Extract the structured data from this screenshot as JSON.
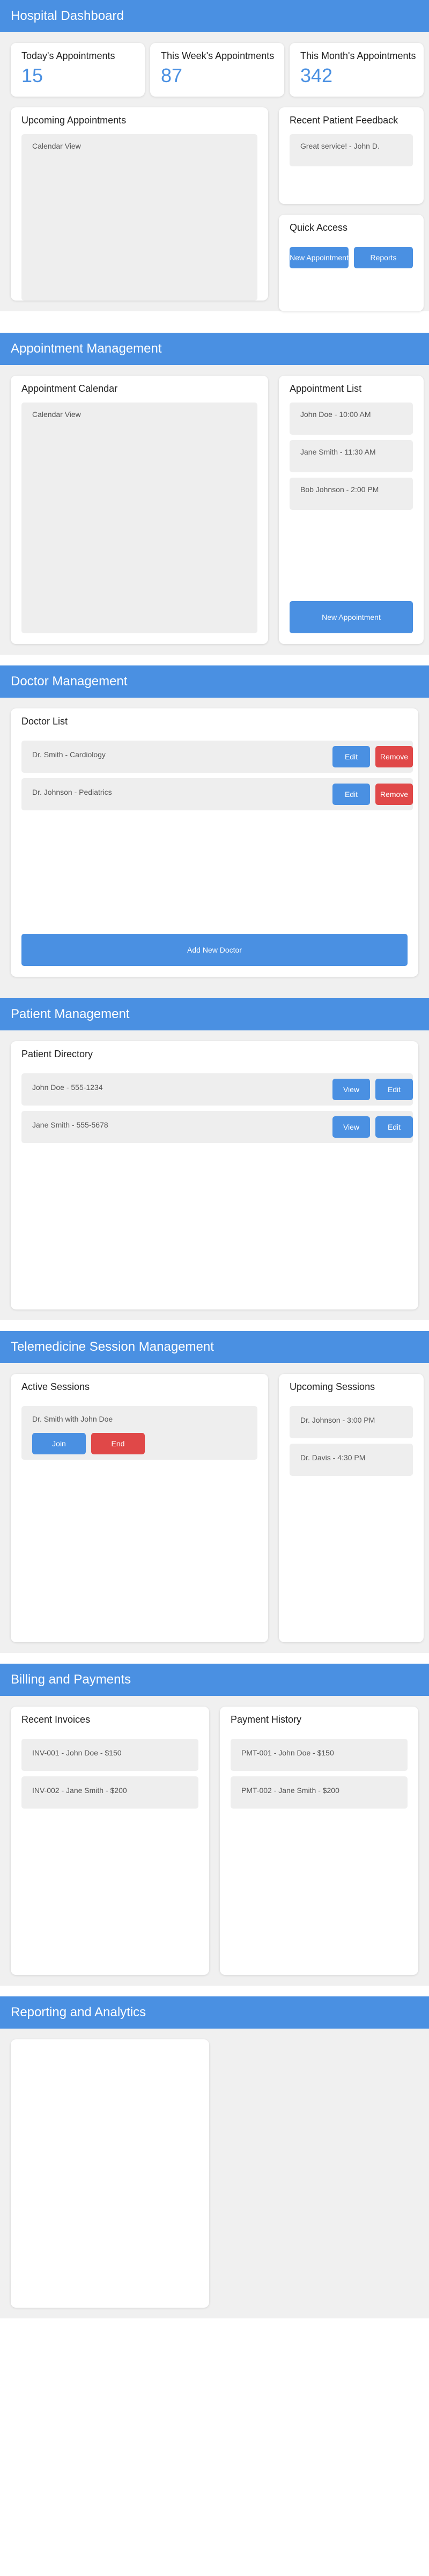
{
  "dashboard": {
    "header": "Hospital Dashboard",
    "stats": [
      {
        "label": "Today's Appointments",
        "value": "15"
      },
      {
        "label": "This Week's Appointments",
        "value": "87"
      },
      {
        "label": "This Month's Appointments",
        "value": "342"
      }
    ],
    "upcoming_title": "Upcoming Appointments",
    "calendar_view_label": "Calendar View",
    "feedback_title": "Recent Patient Feedback",
    "feedback_item": "Great service! - John D.",
    "quick_access_title": "Quick Access",
    "new_appointment_btn": "New Appointment",
    "reports_btn": "Reports"
  },
  "appointments": {
    "header": "Appointment Management",
    "calendar_title": "Appointment Calendar",
    "calendar_view_label": "Calendar View",
    "list_title": "Appointment List",
    "items": [
      "John Doe - 10:00 AM",
      "Jane Smith - 11:30 AM",
      "Bob Johnson - 2:00 PM"
    ],
    "new_appointment_btn": "New Appointment"
  },
  "doctors": {
    "header": "Doctor Management",
    "list_title": "Doctor List",
    "items": [
      "Dr. Smith - Cardiology",
      "Dr. Johnson - Pediatrics"
    ],
    "edit_btn": "Edit",
    "remove_btn": "Remove",
    "add_btn": "Add New Doctor"
  },
  "patients": {
    "header": "Patient Management",
    "directory_title": "Patient Directory",
    "items": [
      "John Doe - 555-1234",
      "Jane Smith - 555-5678"
    ],
    "view_btn": "View",
    "edit_btn": "Edit"
  },
  "telemedicine": {
    "header": "Telemedicine Session Management",
    "active_title": "Active Sessions",
    "active_session": "Dr. Smith with John Doe",
    "join_btn": "Join",
    "end_btn": "End",
    "upcoming_title": "Upcoming Sessions",
    "upcoming_items": [
      "Dr. Johnson - 3:00 PM",
      "Dr. Davis - 4:30 PM"
    ]
  },
  "billing": {
    "header": "Billing and Payments",
    "invoices_title": "Recent Invoices",
    "invoices": [
      "INV-001 - John Doe - $150",
      "INV-002 - Jane Smith - $200"
    ],
    "payments_title": "Payment History",
    "payments": [
      "PMT-001 - John Doe - $150",
      "PMT-002 - Jane Smith - $200"
    ]
  },
  "reporting": {
    "header": "Reporting and Analytics"
  },
  "colors": {
    "primary": "#4a90e2",
    "danger": "#e04848",
    "background": "#f0f0f0",
    "card": "#ffffff"
  }
}
